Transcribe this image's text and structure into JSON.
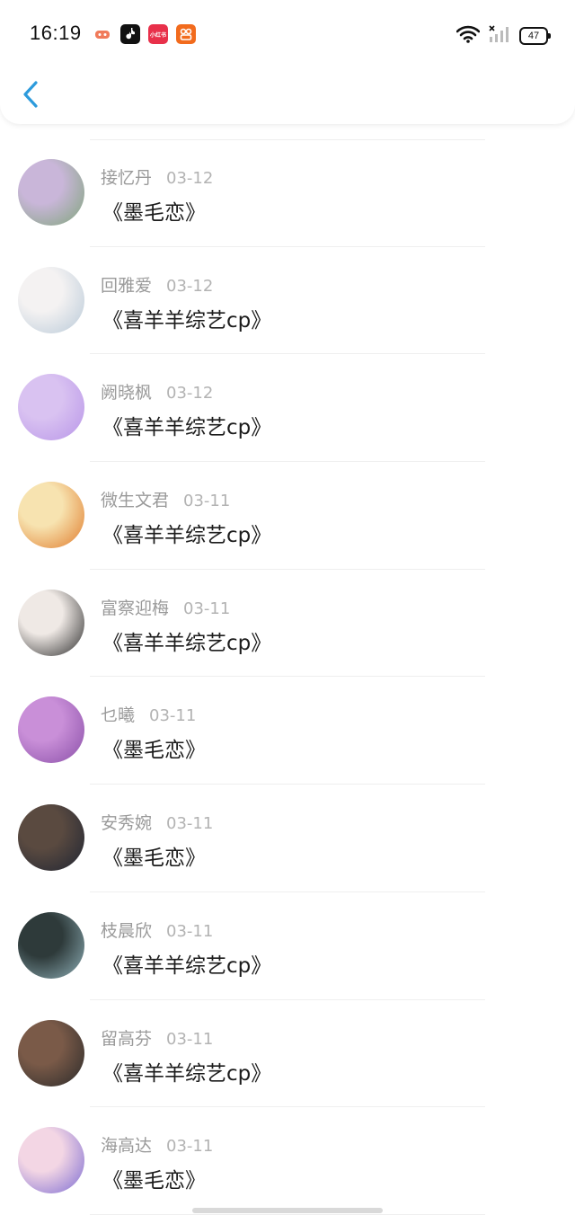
{
  "status_bar": {
    "time": "16:19",
    "battery": "47"
  },
  "nav": {
    "back_icon": "chevron-left-icon"
  },
  "rows": [
    {
      "name": "接忆丹",
      "date": "03-12",
      "title": "《墨毛恋》",
      "avatar_colors": [
        "#c9b6d9",
        "#7fa57a"
      ]
    },
    {
      "name": "回雅爱",
      "date": "03-12",
      "title": "《喜羊羊综艺cp》",
      "avatar_colors": [
        "#f4f2f2",
        "#b8c9d8"
      ]
    },
    {
      "name": "阙晓枫",
      "date": "03-12",
      "title": "《喜羊羊综艺cp》",
      "avatar_colors": [
        "#d9c2f1",
        "#b895e8"
      ]
    },
    {
      "name": "微生文君",
      "date": "03-11",
      "title": "《喜羊羊综艺cp》",
      "avatar_colors": [
        "#f7e3b0",
        "#e07a2a"
      ]
    },
    {
      "name": "富察迎梅",
      "date": "03-11",
      "title": "《喜羊羊综艺cp》",
      "avatar_colors": [
        "#efe9e5",
        "#2b2b2b"
      ]
    },
    {
      "name": "乜曦",
      "date": "03-11",
      "title": "《墨毛恋》",
      "avatar_colors": [
        "#c98fd8",
        "#8a4fa8"
      ]
    },
    {
      "name": "安秀婉",
      "date": "03-11",
      "title": "《墨毛恋》",
      "avatar_colors": [
        "#5a4a40",
        "#1f2533"
      ]
    },
    {
      "name": "枝晨欣",
      "date": "03-11",
      "title": "《喜羊羊综艺cp》",
      "avatar_colors": [
        "#2e3a3a",
        "#8fb0b8"
      ]
    },
    {
      "name": "留高芬",
      "date": "03-11",
      "title": "《喜羊羊综艺cp》",
      "avatar_colors": [
        "#7a5a48",
        "#2a2a2a"
      ]
    },
    {
      "name": "海高达",
      "date": "03-11",
      "title": "《墨毛恋》",
      "avatar_colors": [
        "#f3d6e4",
        "#7b6ad2"
      ]
    }
  ]
}
